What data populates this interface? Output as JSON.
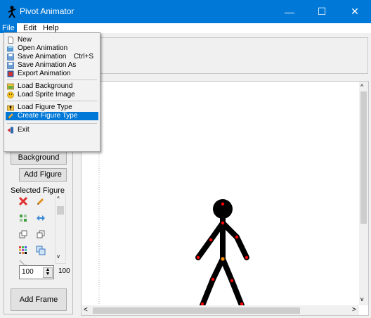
{
  "window": {
    "title": "Pivot Animator",
    "minimize": "—",
    "maximize": "☐",
    "close": "✕"
  },
  "menubar": {
    "items": [
      "File",
      "Edit",
      "Help"
    ]
  },
  "file_menu": {
    "items": [
      {
        "label": "New",
        "shortcut": "",
        "icon": "new-file-icon"
      },
      {
        "label": "Open Animation",
        "shortcut": "",
        "icon": "open-icon"
      },
      {
        "label": "Save Animation",
        "shortcut": "Ctrl+S",
        "icon": "save-icon"
      },
      {
        "label": "Save Animation As",
        "shortcut": "",
        "icon": "save-as-icon"
      },
      {
        "label": "Export Animation",
        "shortcut": "",
        "icon": "export-icon"
      },
      {
        "label": "Load Background",
        "shortcut": "",
        "icon": "background-icon"
      },
      {
        "label": "Load Sprite Image",
        "shortcut": "",
        "icon": "sprite-icon"
      },
      {
        "label": "Load Figure Type",
        "shortcut": "",
        "icon": "figure-type-icon"
      },
      {
        "label": "Create Figure Type",
        "shortcut": "",
        "icon": "pencil-icon"
      },
      {
        "label": "Exit",
        "shortcut": "",
        "icon": "exit-icon"
      }
    ],
    "highlighted": "Create Figure Type"
  },
  "left_panel": {
    "background_button": "Background",
    "add_figure_button": "Add Figure",
    "selected_figure_label": "Selected Figure",
    "size_value": "100",
    "speed_value": "100",
    "add_frame_button": "Add Frame"
  },
  "canvas": {
    "scroll_up": "^",
    "scroll_down": "v",
    "scroll_left": "<",
    "scroll_right": ">"
  },
  "colors": {
    "titlebar": "#0078d7",
    "highlight": "#0078d7",
    "figure": "#000000",
    "joint": "#ff0000",
    "center_joint": "#ff8c00"
  }
}
